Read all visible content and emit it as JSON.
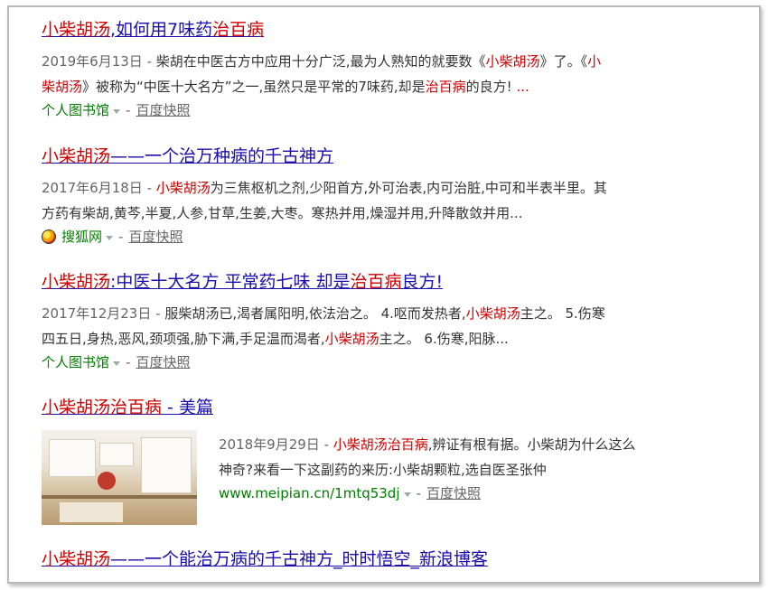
{
  "results": [
    {
      "title": [
        "小柴胡汤",
        ",如何用7味药",
        "治百病",
        ""
      ],
      "date": "2019年6月13日",
      "dash": " - ",
      "snippet_line1": [
        "柴胡在中医古方中应用十分广泛,最为人熟知的就要数《",
        "小柴胡汤",
        "》了。《",
        "小"
      ],
      "snippet_line2": [
        "柴胡汤",
        "》被称为“中医十大名方”之一,虽然只是平常的7味药,却是",
        "治百病",
        "的良方! ",
        "..."
      ],
      "site": "个人图书馆",
      "cache": "百度快照"
    },
    {
      "title": [
        "小柴胡汤",
        "——一个治万种病的千古神方"
      ],
      "date": "2017年6月18日",
      "dash": " - ",
      "snippet_line1": [
        "小柴胡汤",
        "为三焦枢机之剂,少阳首方,外可治表,内可治脏,中可和半表半里。其"
      ],
      "snippet_line2": "方药有柴胡,黄芩,半夏,人参,甘草,生姜,大枣。寒热并用,燥湿并用,升降散敛并用...",
      "site": "搜狐网",
      "site_icon": "sohu-logo-icon",
      "cache": "百度快照"
    },
    {
      "title": [
        "小柴胡汤",
        ":中医十大名方 平常药七味 却是",
        "治百病",
        "良方!"
      ],
      "date": "2017年12月23日",
      "dash": " - ",
      "snippet_line1": [
        "服柴胡汤已,渴者属阳明,依法治之。 4.呕而发热者,",
        "小柴胡汤",
        "主之。 5.伤寒"
      ],
      "snippet_line2": [
        "四五日,身热,恶风,颈项强,胁下满,手足温而渴者,",
        "小柴胡汤",
        "主之。 6.伤寒,阳脉..."
      ],
      "site": "个人图书馆",
      "cache": "百度快照"
    },
    {
      "title": [
        "小柴胡汤治百病",
        " - 美篇"
      ],
      "date": "2018年9月29日",
      "dash": " - ",
      "snippet_line1": [
        "小柴胡汤治百病",
        ",辨证有根有据。小柴胡为什么这么"
      ],
      "snippet_line2": "神奇?来看一下这副药的来历:小柴胡颗粒,选自医圣张仲",
      "site": "www.meipian.cn/1mtq53dj",
      "cache": "百度快照",
      "thumbnail": "clinic-interior-photo"
    },
    {
      "title": [
        "小柴胡汤",
        "——一个能治万病的千古神方_时时悟空_新浪博客"
      ]
    }
  ],
  "colors": {
    "title": "#1a0dab",
    "highlight": "#cc0000",
    "site": "#008000",
    "meta": "#666666"
  }
}
